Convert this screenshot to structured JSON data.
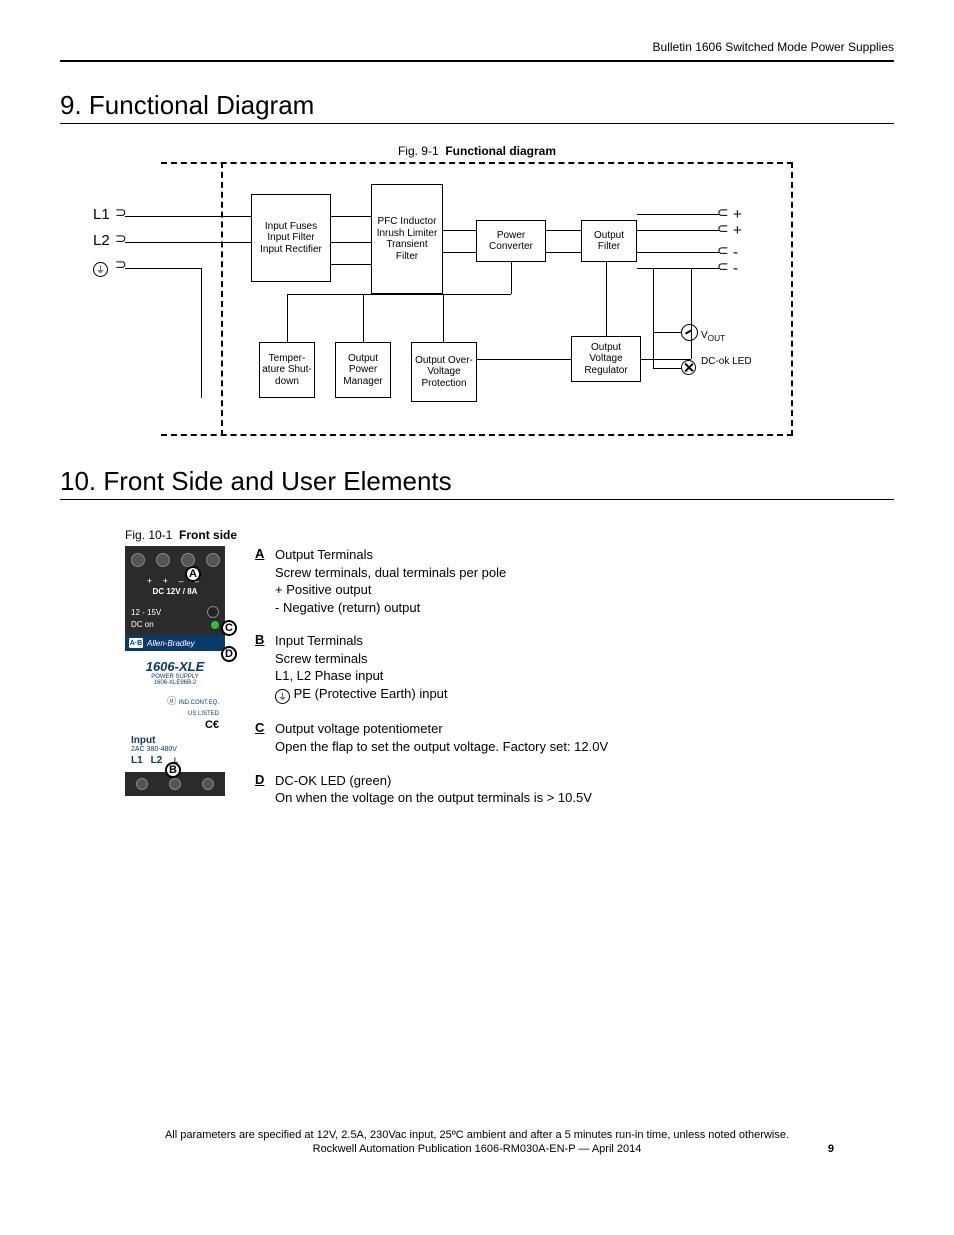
{
  "header": {
    "doc_title": "Bulletin 1606 Switched Mode Power Supplies"
  },
  "sections": {
    "s9": {
      "title": "9. Functional Diagram"
    },
    "s10": {
      "title": "10. Front Side and User Elements"
    }
  },
  "fig9": {
    "caption_prefix": "Fig. 9-1",
    "caption_bold": "Functional diagram",
    "inputs": {
      "l1": "L1",
      "l2": "L2"
    },
    "blocks": {
      "input": "Input Fuses\nInput Filter\nInput Rectifier",
      "pfc": "PFC Inductor\nInrush Limiter\nTransient Filter",
      "conv": "Power Converter",
      "outfilter": "Output Filter",
      "regulator": "Output Voltage Regulator",
      "ovp": "Output Over-Voltage Protection",
      "opm": "Output Power Manager",
      "temp": "Temper-ature Shut-down"
    },
    "outputs": {
      "vout": "VOUT",
      "dcok": "DC-ok LED"
    }
  },
  "fig10": {
    "caption_prefix": "Fig. 10-1",
    "caption_bold": "Front side",
    "device": {
      "dc_label": "DC 12V / 8A",
      "v_range": "12 - 15V",
      "dc_on": "DC on",
      "brand": "Allen-Bradley",
      "model": "1606-XLE",
      "model_sub1": "POWER SUPPLY",
      "model_sub2": "1606-XLE96B-2",
      "input": "Input",
      "input_sub": "2AC 380-480V",
      "l1": "L1",
      "l2": "L2"
    },
    "desc": {
      "A": {
        "title": "Output Terminals",
        "l1": "Screw terminals, dual terminals per pole",
        "l2": "+  Positive output",
        "l3": "-   Negative (return) output"
      },
      "B": {
        "title": "Input Terminals",
        "l1": "Screw terminals",
        "l2": "L1, L2   Phase input",
        "l3": "PE (Protective Earth) input"
      },
      "C": {
        "title": "Output voltage potentiometer",
        "l1": "Open the flap to set the output voltage. Factory set: 12.0V"
      },
      "D": {
        "title": "DC-OK LED (green)",
        "l1": "On when the voltage on the output terminals is > 10.5V"
      }
    }
  },
  "footer": {
    "line1": "All parameters are specified at 12V, 2.5A, 230Vac input, 25ºC ambient and after a 5 minutes run-in time, unless noted otherwise.",
    "line2": "Rockwell Automation Publication 1606-RM030A-EN-P — April 2014",
    "page": "9"
  }
}
